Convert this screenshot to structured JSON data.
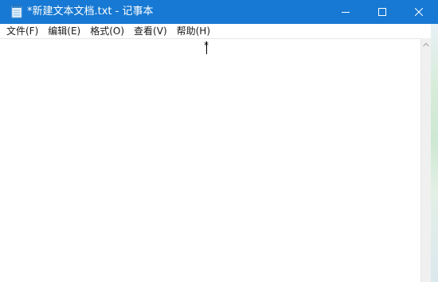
{
  "window": {
    "title": "*新建文本文档.txt - 记事本",
    "title_bar_color": "#1779d3"
  },
  "menu": {
    "items": [
      {
        "label": "文件(F)"
      },
      {
        "label": "编辑(E)"
      },
      {
        "label": "格式(O)"
      },
      {
        "label": "查看(V)"
      },
      {
        "label": "帮助(H)"
      }
    ]
  },
  "editor": {
    "text": "*"
  },
  "icons": {
    "app": "notepad-icon",
    "minimize": "minimize-icon",
    "maximize": "maximize-icon",
    "close": "close-icon",
    "scroll_up": "scroll-up-arrow-icon"
  }
}
